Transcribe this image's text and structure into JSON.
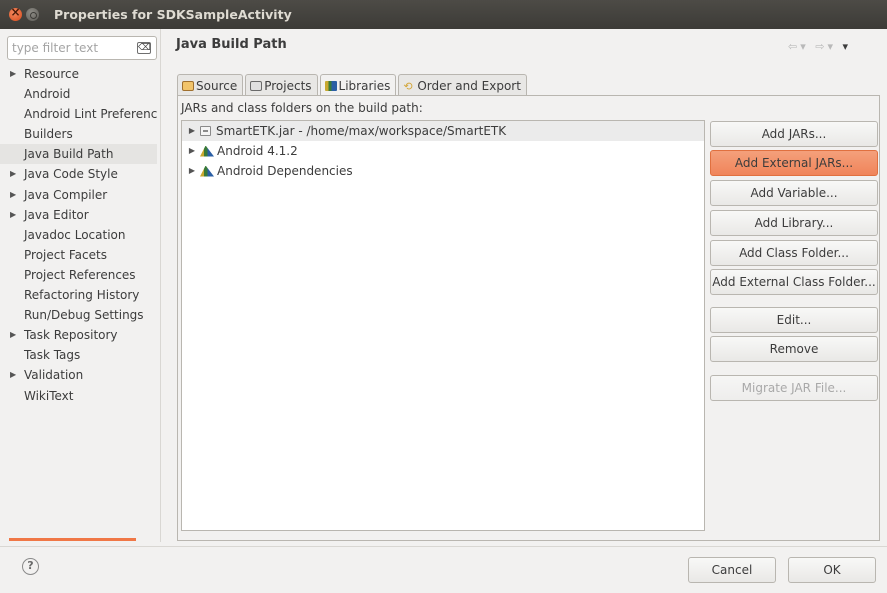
{
  "window": {
    "title": "Properties for SDKSampleActivity"
  },
  "filter": {
    "placeholder": "type filter text",
    "clear_icon": "⌫"
  },
  "left_tree": {
    "items": [
      {
        "label": "Resource",
        "expandable": true
      },
      {
        "label": "Android",
        "expandable": false
      },
      {
        "label": "Android Lint Preferences",
        "expandable": false
      },
      {
        "label": "Builders",
        "expandable": false
      },
      {
        "label": "Java Build Path",
        "expandable": false,
        "selected": true
      },
      {
        "label": "Java Code Style",
        "expandable": true
      },
      {
        "label": "Java Compiler",
        "expandable": true
      },
      {
        "label": "Java Editor",
        "expandable": true
      },
      {
        "label": "Javadoc Location",
        "expandable": false
      },
      {
        "label": "Project Facets",
        "expandable": false
      },
      {
        "label": "Project References",
        "expandable": false
      },
      {
        "label": "Refactoring History",
        "expandable": false
      },
      {
        "label": "Run/Debug Settings",
        "expandable": false
      },
      {
        "label": "Task Repository",
        "expandable": true
      },
      {
        "label": "Task Tags",
        "expandable": false
      },
      {
        "label": "Validation",
        "expandable": true
      },
      {
        "label": "WikiText",
        "expandable": false
      }
    ]
  },
  "page": {
    "title": "Java Build Path",
    "nav": {
      "back": "⇦",
      "dropdown1": "▾",
      "forward": "⇨",
      "dropdown2": "▾",
      "menu": "▾"
    }
  },
  "tabs": [
    {
      "label": "Source",
      "icon": "source-folder-icon",
      "active": false
    },
    {
      "label": "Projects",
      "icon": "projects-icon",
      "active": false
    },
    {
      "label": "Libraries",
      "icon": "libraries-icon",
      "active": true
    },
    {
      "label": "Order and Export",
      "icon": "order-export-icon",
      "active": false
    }
  ],
  "libraries": {
    "label": "JARs and class folders on the build path:",
    "entries": [
      {
        "label": "SmartETK.jar - /home/max/workspace/SmartETK",
        "icon": "jar-icon",
        "selected": true
      },
      {
        "label": "Android 4.1.2",
        "icon": "library-icon",
        "selected": false
      },
      {
        "label": "Android Dependencies",
        "icon": "library-icon",
        "selected": false
      }
    ]
  },
  "buttons": {
    "add_jars": "Add JARs...",
    "add_external_jars": "Add External JARs...",
    "add_variable": "Add Variable...",
    "add_library": "Add Library...",
    "add_class_folder": "Add Class Folder...",
    "add_external_class_folder": "Add External Class Folder...",
    "edit": "Edit...",
    "remove": "Remove",
    "migrate_jar": "Migrate JAR File..."
  },
  "footer": {
    "help": "?",
    "cancel": "Cancel",
    "ok": "OK"
  },
  "colors": {
    "accent": "#f0845a",
    "titlebar": "#3c3b37"
  }
}
